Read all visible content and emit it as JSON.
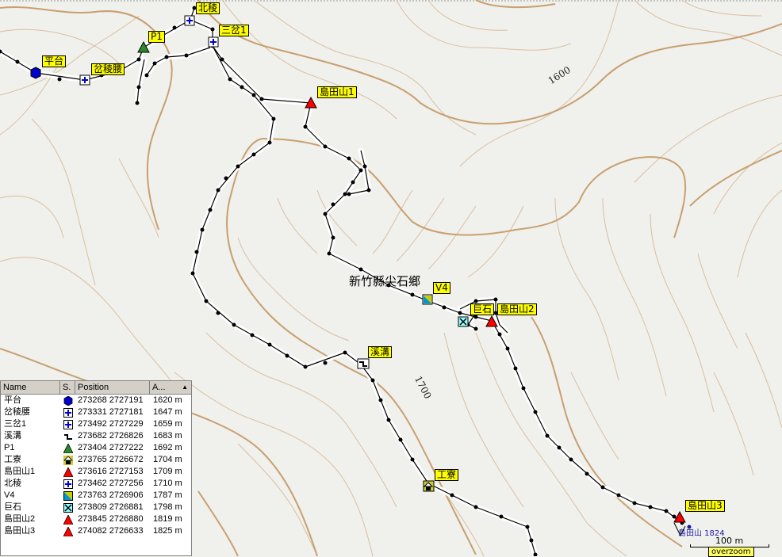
{
  "map": {
    "place_name": "新竹縣尖石鄉",
    "contour_labels": [
      "1600",
      "1700"
    ],
    "peak_label": "島田山 1824",
    "scale_label": "100 m",
    "overzoom_label": "overzoom"
  },
  "waypoint_labels": {
    "platform": "平台",
    "junction_ridge": "岔稜腰",
    "sancha1": "三岔1",
    "north_ridge": "北稜",
    "p1": "P1",
    "doutian1": "島田山1",
    "v4": "V4",
    "boulder": "巨石",
    "doutian2": "島田山2",
    "stream": "溪溝",
    "worker_hut": "工寮",
    "doutian3": "島田山3"
  },
  "table": {
    "headers": [
      "Name",
      "S.",
      "Position",
      "A..."
    ],
    "rows": [
      {
        "name": "平台",
        "symbol": "hexagon-blue-icon",
        "position": "273268 2727191",
        "alt": "1620 m"
      },
      {
        "name": "岔稜腰",
        "symbol": "cross-box-icon",
        "position": "273331 2727181",
        "alt": "1647 m"
      },
      {
        "name": "三岔1",
        "symbol": "cross-box-icon",
        "position": "273492 2727229",
        "alt": "1659 m"
      },
      {
        "name": "溪溝",
        "symbol": "stream-icon",
        "position": "273682 2726826",
        "alt": "1683 m"
      },
      {
        "name": "P1",
        "symbol": "green-triangle-icon",
        "position": "273404 2727222",
        "alt": "1692 m"
      },
      {
        "name": "工寮",
        "symbol": "hut-icon",
        "position": "273765 2726672",
        "alt": "1704 m"
      },
      {
        "name": "島田山1",
        "symbol": "red-triangle-icon",
        "position": "273616 2727153",
        "alt": "1709 m"
      },
      {
        "name": "北稜",
        "symbol": "cross-box-icon",
        "position": "273462 2727256",
        "alt": "1710 m"
      },
      {
        "name": "V4",
        "symbol": "view-icon",
        "position": "273763 2726906",
        "alt": "1787 m"
      },
      {
        "name": "巨石",
        "symbol": "boulder-icon",
        "position": "273809 2726881",
        "alt": "1798 m"
      },
      {
        "name": "島田山2",
        "symbol": "red-triangle-icon",
        "position": "273845 2726880",
        "alt": "1819 m"
      },
      {
        "name": "島田山3",
        "symbol": "red-triangle-icon",
        "position": "274082 2726633",
        "alt": "1825 m"
      }
    ]
  },
  "colors": {
    "background": "#f0f0ec",
    "contour_index": "#c8a070",
    "contour": "#d8c0a0",
    "track_halo": "#ffffff",
    "track": "#000000",
    "label_bg": "#ffff00",
    "summit_red": "#ff0000",
    "junction_blue": "#0000cc"
  }
}
